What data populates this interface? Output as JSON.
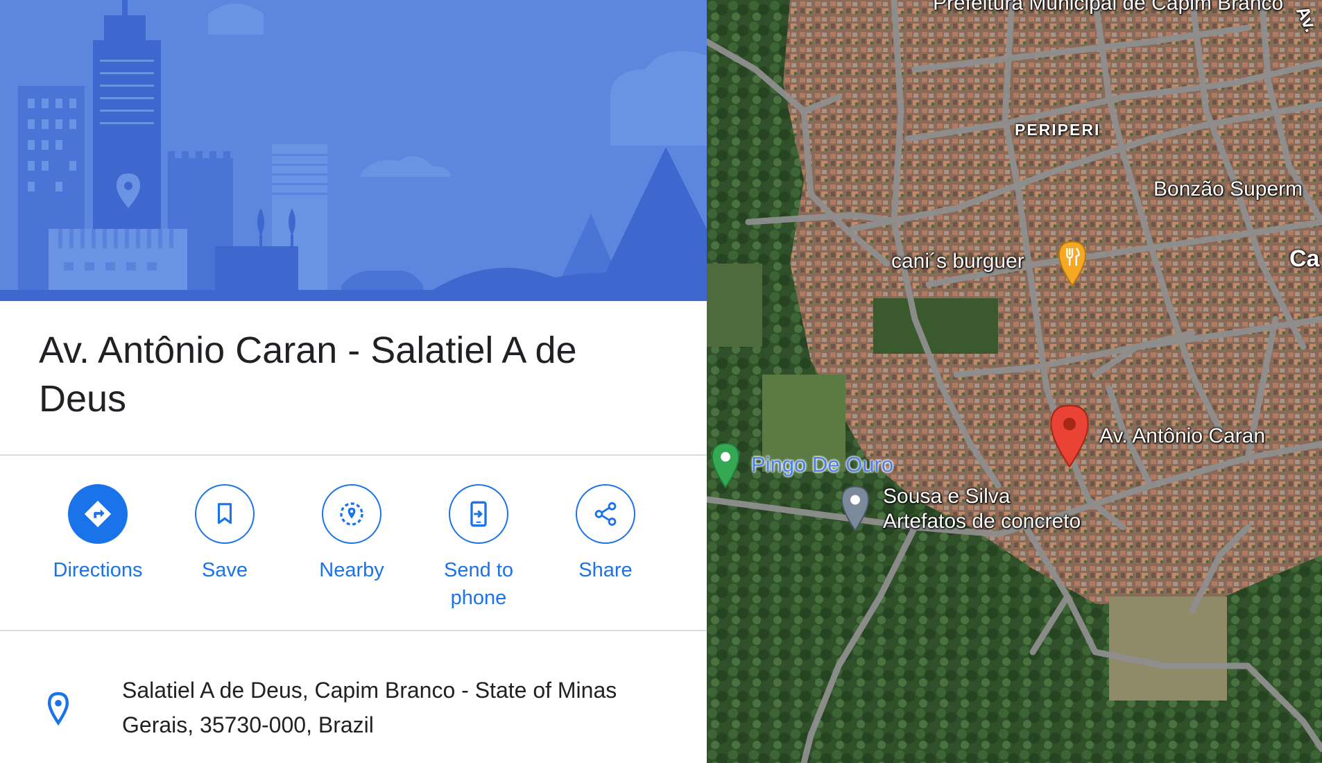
{
  "place": {
    "title": "Av. Antônio Caran - Salatiel A de Deus",
    "address": "Salatiel A de Deus, Capim Branco - State of Minas Gerais, 35730-000, Brazil"
  },
  "actions": [
    {
      "label": "Directions",
      "icon": "directions-icon"
    },
    {
      "label": "Save",
      "icon": "bookmark-icon"
    },
    {
      "label": "Nearby",
      "icon": "nearby-icon"
    },
    {
      "label": "Send to phone",
      "icon": "send-to-phone-icon"
    },
    {
      "label": "Share",
      "icon": "share-icon"
    }
  ],
  "map": {
    "labels": {
      "prefeitura": "Prefeitura Municipal de Capim Branco",
      "periperi": "PERIPERI",
      "bonzao": "Bonzão Superm",
      "ca": "Ca",
      "av_corner": "Av.",
      "canis": "cani´s burguer",
      "pingo": "Pingo De Ouro",
      "sousa_line1": "Sousa e Silva",
      "sousa_line2": "Artefatos de concreto",
      "selected": "Av. Antônio Caran"
    }
  },
  "colors": {
    "accent": "#1a73e8",
    "hero_bg": "#5b83db",
    "selected_pin": "#ea4335",
    "restaurant_pin": "#f4a824",
    "park_pin": "#34a853",
    "generic_pin": "#7b8a9a"
  }
}
